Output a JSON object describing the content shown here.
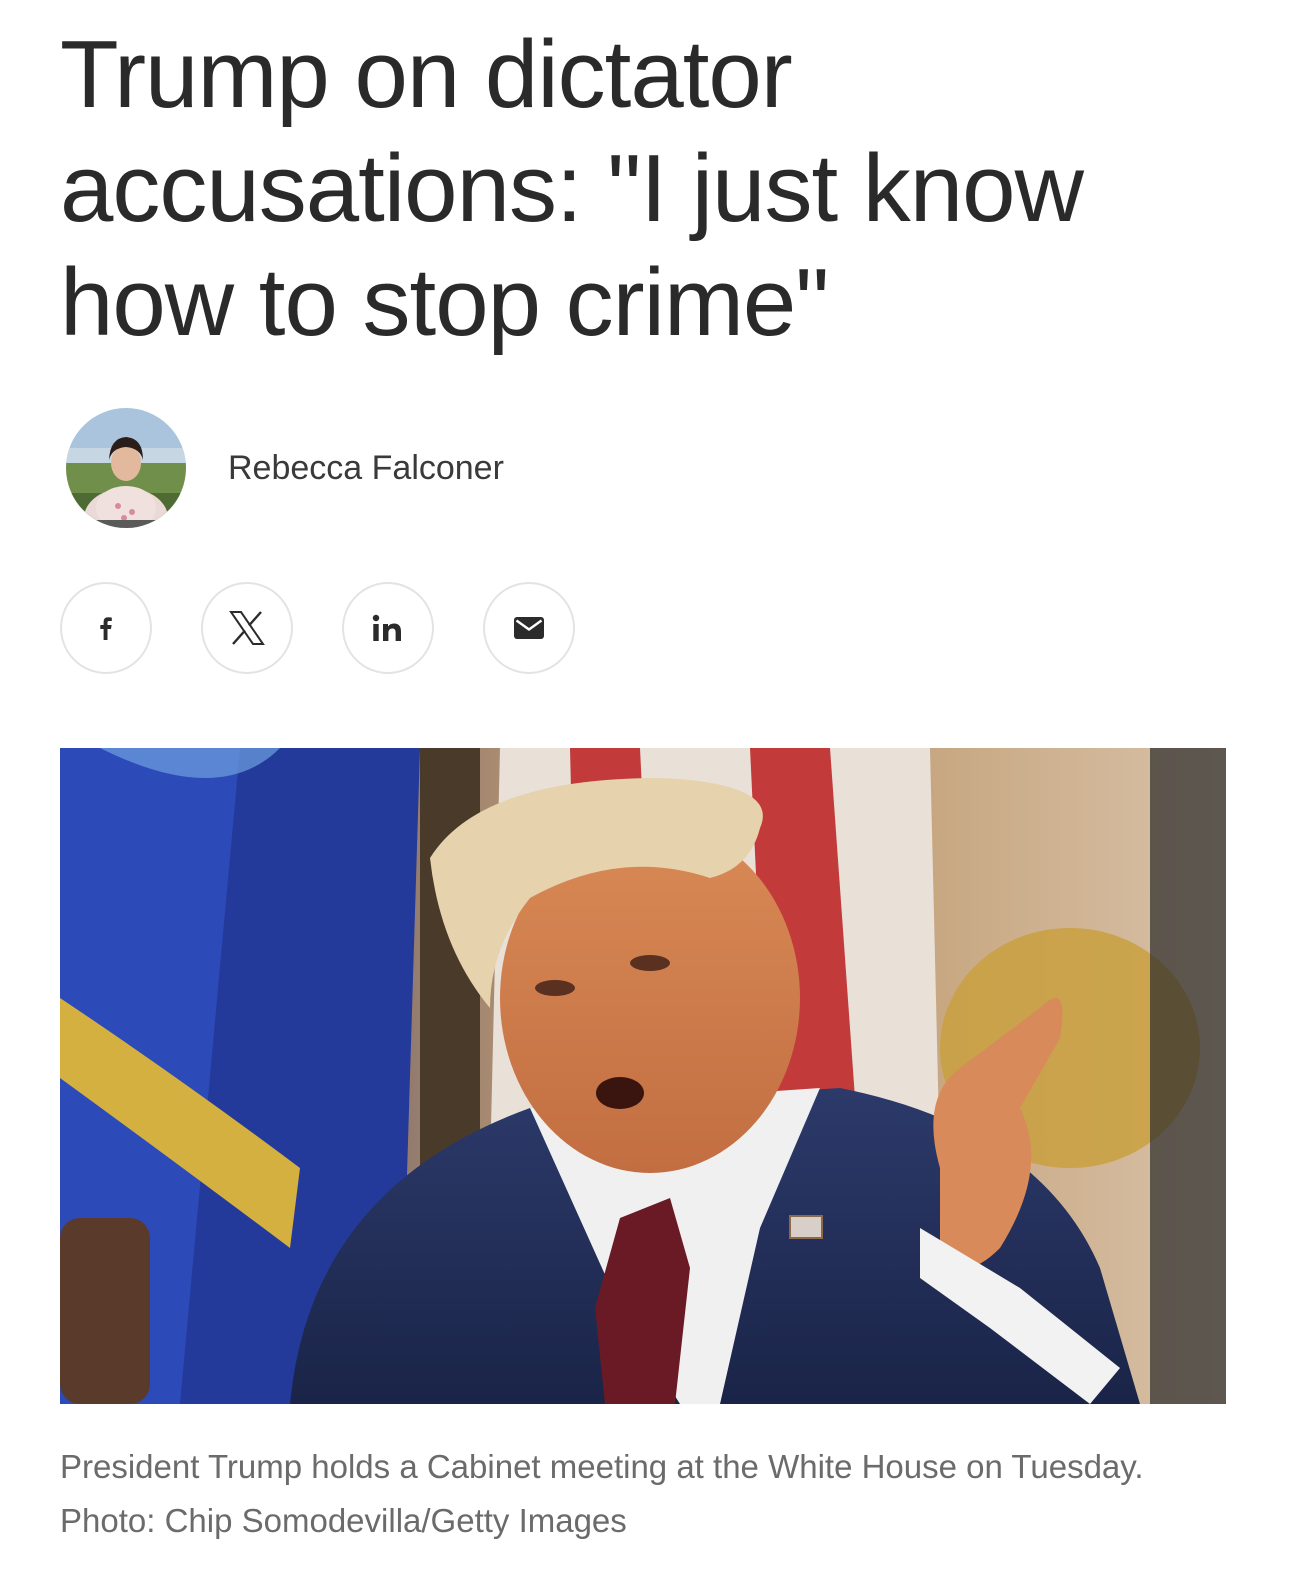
{
  "article": {
    "headline": "Trump on dictator accusations: \"I just know how to stop crime\"",
    "author": "Rebecca Falconer",
    "caption": "President Trump holds a Cabinet meeting at the White House on Tuesday. Photo: Chip Somodevilla/Getty Images"
  },
  "share_buttons": [
    {
      "icon": "facebook-icon"
    },
    {
      "icon": "x-icon"
    },
    {
      "icon": "linkedin-icon"
    },
    {
      "icon": "email-icon"
    }
  ],
  "colors": {
    "headline": "#2a2a2a",
    "caption": "#6b6b6b",
    "button_border": "#e3e3e3"
  }
}
